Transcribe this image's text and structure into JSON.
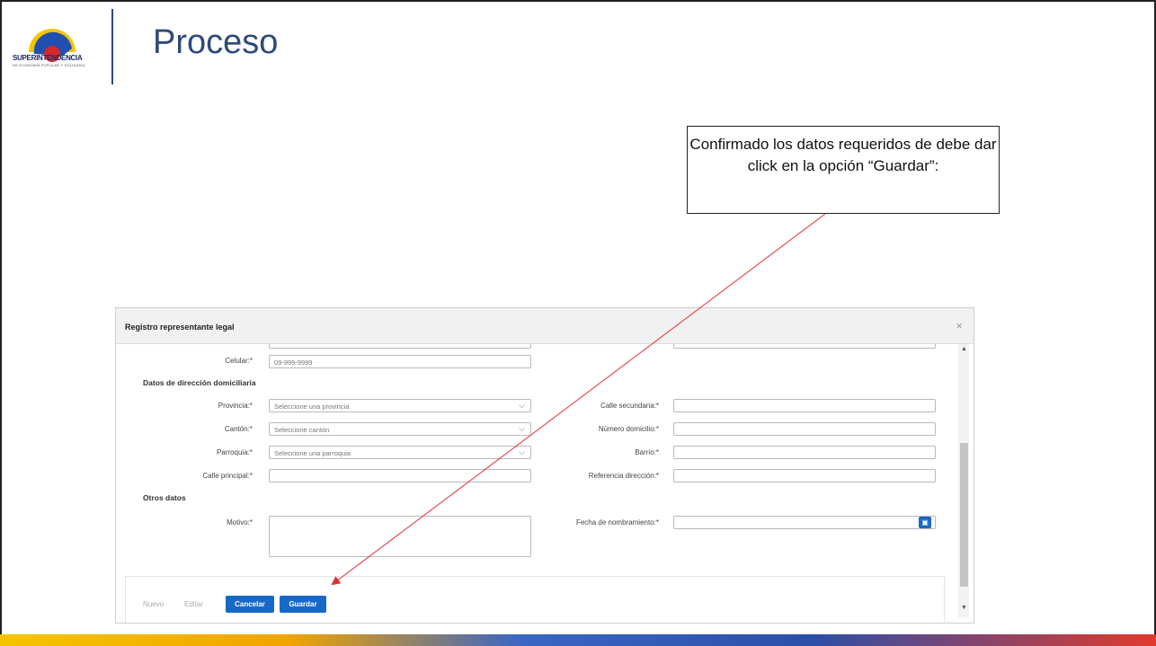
{
  "slide": {
    "title": "Proceso",
    "logo_text": "SUPERINTENDENCIA",
    "logo_subtext": "DE ECONOMÍA POPULAR Y SOLIDARIA",
    "callout_text": "Confirmado los datos requeridos de debe dar click en la opción “Guardar”:"
  },
  "dialog": {
    "title": "Registro representante legal",
    "close_symbol": "×",
    "celular": {
      "label": "Celular:*",
      "value": "09-999-9999"
    },
    "section_direccion": "Datos de dirección domiciliaria",
    "provincia": {
      "label": "Provincia:*",
      "placeholder": "Seleccione una provincia"
    },
    "canton": {
      "label": "Cantón:*",
      "placeholder": "Seleccione cantón"
    },
    "parroquia": {
      "label": "Parroquia:*",
      "placeholder": "Seleccione una parroquia"
    },
    "calle_principal": {
      "label": "Calle principal:*",
      "value": ""
    },
    "calle_secundaria": {
      "label": "Calle secundaria:*",
      "value": ""
    },
    "numero_domicilio": {
      "label": "Número domicilio:*",
      "value": ""
    },
    "barrio": {
      "label": "Barrio:*",
      "value": ""
    },
    "referencia": {
      "label": "Referencia dirección:*",
      "value": ""
    },
    "section_otros": "Otros datos",
    "motivo": {
      "label": "Motivo:*",
      "value": ""
    },
    "fecha": {
      "label": "Fecha de nombramiento:*",
      "value": ""
    },
    "buttons": {
      "nuevo": "Nuevo",
      "editar": "Editar",
      "cancelar": "Cancelar",
      "guardar": "Guardar"
    }
  },
  "colors": {
    "primary_button": "#1769c7",
    "title": "#2f4a7a",
    "annotation_arrow": "#e03030"
  },
  "icons": [
    "logo-icon",
    "close-icon",
    "chevron-down-icon",
    "calendar-icon",
    "scroll-up-icon",
    "scroll-down-icon"
  ]
}
